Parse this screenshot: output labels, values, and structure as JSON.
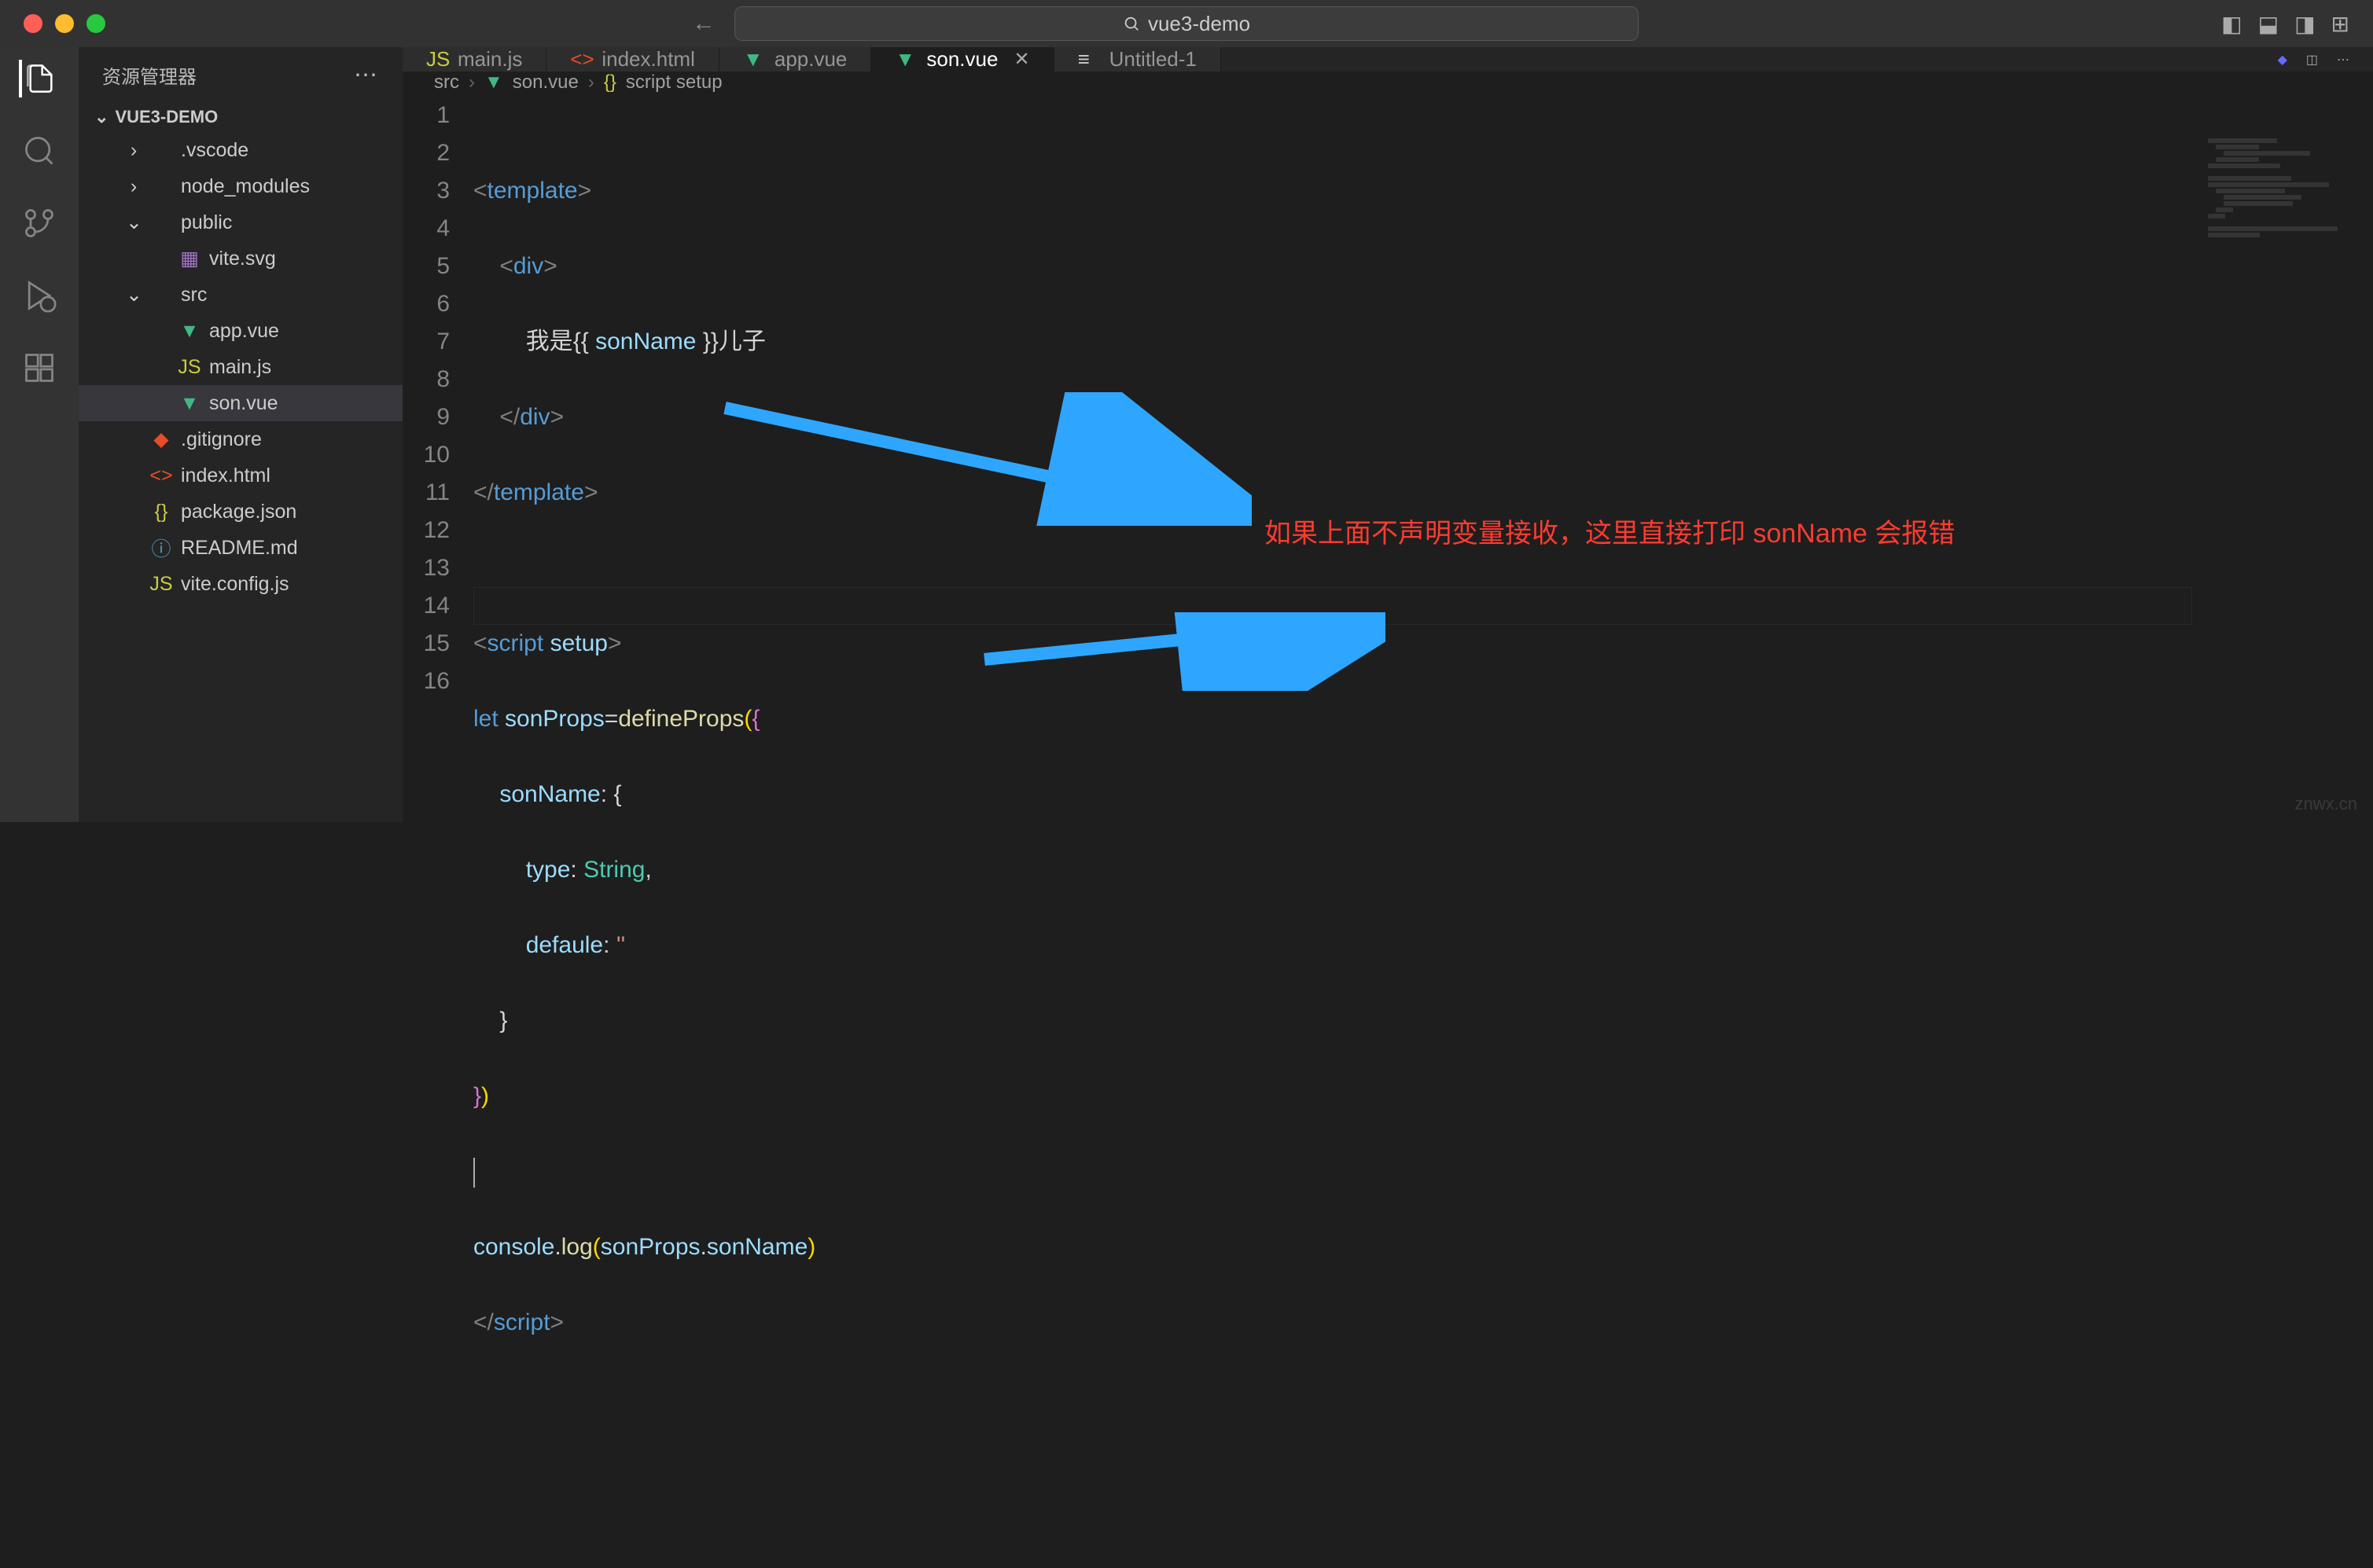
{
  "window": {
    "search": "vue3-demo"
  },
  "sidebar": {
    "title": "资源管理器",
    "project": "VUE3-DEMO",
    "tree": [
      {
        "label": ".vscode",
        "type": "folder",
        "open": false,
        "indent": 1
      },
      {
        "label": "node_modules",
        "type": "folder",
        "open": false,
        "indent": 1
      },
      {
        "label": "public",
        "type": "folder",
        "open": true,
        "indent": 1
      },
      {
        "label": "vite.svg",
        "type": "svg",
        "indent": 2
      },
      {
        "label": "src",
        "type": "folder",
        "open": true,
        "indent": 1
      },
      {
        "label": "app.vue",
        "type": "vue",
        "indent": 2
      },
      {
        "label": "main.js",
        "type": "js",
        "indent": 2
      },
      {
        "label": "son.vue",
        "type": "vue",
        "indent": 2,
        "selected": true
      },
      {
        "label": ".gitignore",
        "type": "git",
        "indent": 1
      },
      {
        "label": "index.html",
        "type": "html",
        "indent": 1
      },
      {
        "label": "package.json",
        "type": "json",
        "indent": 1
      },
      {
        "label": "README.md",
        "type": "md",
        "indent": 1
      },
      {
        "label": "vite.config.js",
        "type": "js",
        "indent": 1
      }
    ]
  },
  "tabs": [
    {
      "label": "main.js",
      "icon": "js"
    },
    {
      "label": "index.html",
      "icon": "html"
    },
    {
      "label": "app.vue",
      "icon": "vue"
    },
    {
      "label": "son.vue",
      "icon": "vue",
      "active": true,
      "close": true
    },
    {
      "label": "Untitled-1",
      "icon": "file"
    }
  ],
  "breadcrumbs": [
    "src",
    "son.vue",
    "script setup"
  ],
  "code": {
    "lines": 16,
    "l3_text": "我是",
    "l3_var": "sonName",
    "l3_text2": "儿子",
    "l8_var": "sonProps",
    "l8_fn": "defineProps",
    "l9_prop": "sonName",
    "l10_prop": "type",
    "l10_val": "String",
    "l11_prop": "defaule",
    "l11_val": "''",
    "l15_obj": "console",
    "l15_fn": "log",
    "l15_arg1": "sonProps",
    "l15_arg2": "sonName"
  },
  "annotation": "如果上面不声明变量接收，这里直接打印 sonName 会报错",
  "watermark": "znwx.cn"
}
